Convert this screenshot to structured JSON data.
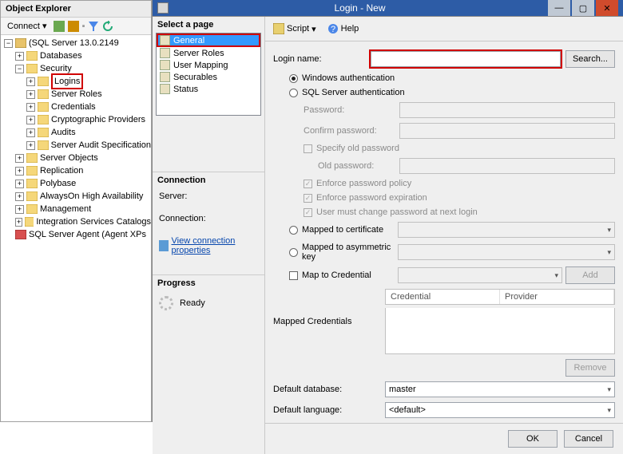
{
  "objectExplorer": {
    "title": "Object Explorer",
    "connectLabel": "Connect",
    "serverNode": "(SQL Server 13.0.2149",
    "nodes": {
      "databases": "Databases",
      "security": "Security",
      "logins": "Logins",
      "serverRoles": "Server Roles",
      "credentials": "Credentials",
      "cryptographic": "Cryptographic Providers",
      "audits": "Audits",
      "serverAuditSpec": "Server Audit Specification",
      "serverObjects": "Server Objects",
      "replication": "Replication",
      "polybase": "Polybase",
      "alwaysOn": "AlwaysOn High Availability",
      "management": "Management",
      "integration": "Integration Services Catalogs",
      "sqlAgent": "SQL Server Agent (Agent XPs"
    }
  },
  "dialog": {
    "title": "Login - New",
    "selectPage": "Select a page",
    "pages": [
      "General",
      "Server Roles",
      "User Mapping",
      "Securables",
      "Status"
    ],
    "connection": {
      "header": "Connection",
      "serverLabel": "Server:",
      "connectionLabel": "Connection:",
      "viewProps": "View connection properties"
    },
    "progress": {
      "header": "Progress",
      "status": "Ready"
    },
    "toolbar": {
      "script": "Script",
      "help": "Help"
    },
    "form": {
      "loginNameLabel": "Login name:",
      "searchBtn": "Search...",
      "winAuth": "Windows authentication",
      "sqlAuth": "SQL Server authentication",
      "passwordLabel": "Password:",
      "confirmLabel": "Confirm password:",
      "specifyOld": "Specify old password",
      "oldPwdLabel": "Old password:",
      "enforcePolicy": "Enforce password policy",
      "enforceExpiry": "Enforce password expiration",
      "mustChange": "User must change password at next login",
      "mappedCert": "Mapped to certificate",
      "mappedAsym": "Mapped to asymmetric key",
      "mapToCred": "Map to Credential",
      "addBtn": "Add",
      "mappedCredsLabel": "Mapped Credentials",
      "credCol": "Credential",
      "provCol": "Provider",
      "removeBtn": "Remove",
      "defaultDb": "Default database:",
      "defaultDbVal": "master",
      "defaultLang": "Default language:",
      "defaultLangVal": "<default>"
    },
    "footer": {
      "ok": "OK",
      "cancel": "Cancel"
    }
  }
}
